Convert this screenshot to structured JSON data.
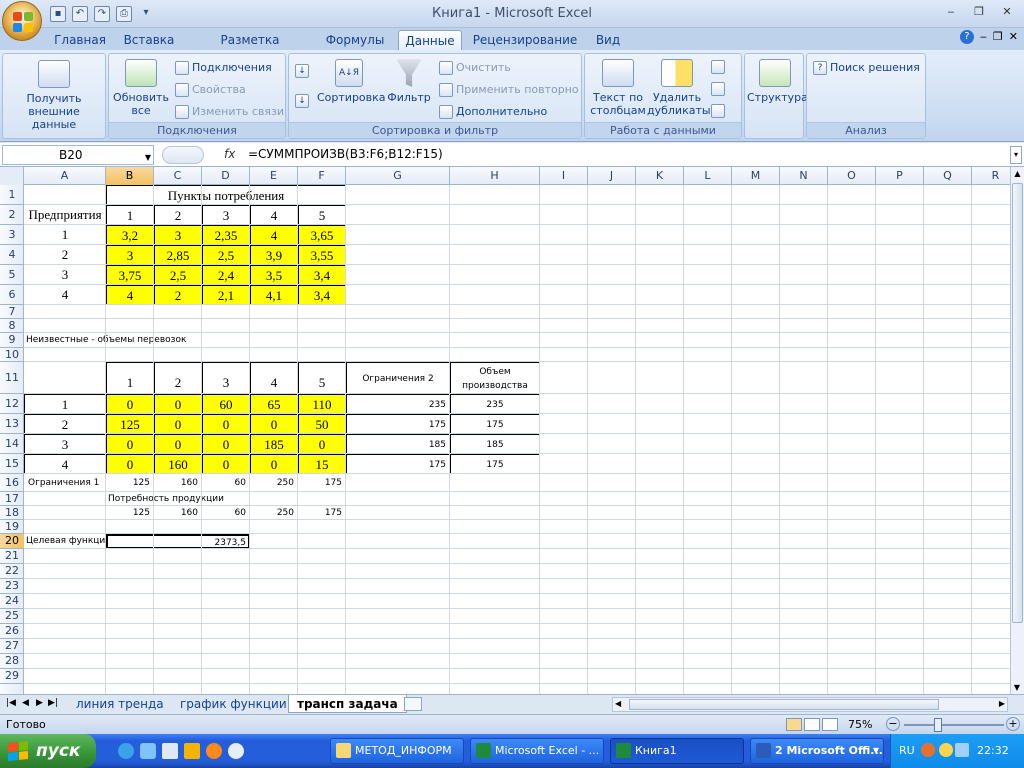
{
  "window": {
    "title": "Книга1 - Microsoft Excel"
  },
  "ribbon": {
    "tabs": [
      "Главная",
      "Вставка",
      "Разметка страницы",
      "Формулы",
      "Данные",
      "Рецензирование",
      "Вид"
    ],
    "active_tab": "Данные",
    "groups": {
      "get_external": {
        "label": "Получить внешние данные"
      },
      "connections": {
        "label": "Подключения",
        "refresh_all": "Обновить все",
        "connections_btn": "Подключения",
        "properties": "Свойства",
        "edit_links": "Изменить связи"
      },
      "sort_filter": {
        "label": "Сортировка и фильтр",
        "sort_az": "А↓Я",
        "sort": "Сортировка",
        "filter": "Фильтр",
        "clear": "Очистить",
        "reapply": "Применить повторно",
        "advanced": "Дополнительно"
      },
      "data_tools": {
        "label": "Работа с данными",
        "text_to_columns": "Текст по столбцам",
        "remove_duplicates": "Удалить дубликаты"
      },
      "outline": {
        "label": "Структура"
      },
      "analysis": {
        "label": "Анализ",
        "solver": "Поиск решения"
      }
    }
  },
  "formula_bar": {
    "name_box": "B20",
    "fx": "fx",
    "formula": "=СУММПРОИЗВ(B3:F6;B12:F15)"
  },
  "columns": [
    "A",
    "B",
    "C",
    "D",
    "E",
    "F",
    "G",
    "H",
    "I",
    "J",
    "K",
    "L",
    "M",
    "N",
    "O",
    "P",
    "Q",
    "R"
  ],
  "rows": [
    "1",
    "2",
    "3",
    "4",
    "5",
    "6",
    "7",
    "8",
    "9",
    "10",
    "11",
    "12",
    "13",
    "14",
    "15",
    "16",
    "17",
    "18",
    "19",
    "20",
    "21",
    "22",
    "23",
    "24",
    "25",
    "26",
    "27",
    "28",
    "29"
  ],
  "sheet": {
    "header_consumption": "Пункты потребления",
    "enterprises_label": "Предприятия",
    "col_numbers": [
      "1",
      "2",
      "3",
      "4",
      "5"
    ],
    "row_numbers": [
      "1",
      "2",
      "3",
      "4"
    ],
    "costs": [
      [
        "3,2",
        "3",
        "2,35",
        "4",
        "3,65"
      ],
      [
        "3",
        "2,85",
        "2,5",
        "3,9",
        "3,55"
      ],
      [
        "3,75",
        "2,5",
        "2,4",
        "3,5",
        "3,4"
      ],
      [
        "4",
        "2",
        "2,1",
        "4,1",
        "3,4"
      ]
    ],
    "unknowns_label": "Неизвестные - объемы перевозок",
    "volumes": [
      [
        "0",
        "0",
        "60",
        "65",
        "110"
      ],
      [
        "125",
        "0",
        "0",
        "0",
        "50"
      ],
      [
        "0",
        "0",
        "0",
        "185",
        "0"
      ],
      [
        "0",
        "160",
        "0",
        "0",
        "15"
      ]
    ],
    "constraints2_label": "Ограничения 2",
    "production_label": "Объем производства",
    "constraints2": [
      "235",
      "175",
      "185",
      "175"
    ],
    "production": [
      "235",
      "175",
      "185",
      "175"
    ],
    "constraints1_label": "Ограничения 1",
    "constraints1": [
      "125",
      "160",
      "60",
      "250",
      "175"
    ],
    "demand_label": "Потребность продукции",
    "demand": [
      "125",
      "160",
      "60",
      "250",
      "175"
    ],
    "objective_label": "Целевая функция",
    "objective_value": "2373,5"
  },
  "sheet_tabs": [
    "линия тренда",
    "график функции",
    "трансп задача"
  ],
  "active_sheet": "трансп задача",
  "status": {
    "ready": "Готово",
    "zoom": "75%"
  },
  "taskbar": {
    "start": "пуск",
    "tasks": [
      "МЕТОД_ИНФОРМ",
      "Microsoft Excel - ...",
      "Книга1",
      "2 Microsoft Offi..."
    ],
    "lang": "RU",
    "time": "22:32"
  }
}
